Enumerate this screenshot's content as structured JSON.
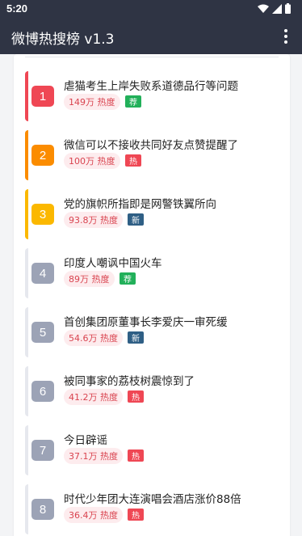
{
  "status_bar": {
    "time": "5:20"
  },
  "app_bar": {
    "title": "微博热搜榜 v1.3",
    "menu_icon": "more-vert-icon"
  },
  "colors": {
    "rank_1": "#ef4754",
    "rank_2": "#fb8c00",
    "rank_3": "#fbb800",
    "rank_other": "#9ca3b6",
    "tag_recommend": "#22b05a",
    "tag_hot": "#ef4754",
    "tag_new": "#2f5f85"
  },
  "items": [
    {
      "rank": "1",
      "title": "虐猫考生上岸失败系道德品行等问题",
      "heat": "149万 热度",
      "tag": "荐",
      "tag_type": "recommend"
    },
    {
      "rank": "2",
      "title": "微信可以不接收共同好友点赞提醒了",
      "heat": "100万 热度",
      "tag": "热",
      "tag_type": "hot"
    },
    {
      "rank": "3",
      "title": "党的旗帜所指即是网警铁翼所向",
      "heat": "93.8万 热度",
      "tag": "新",
      "tag_type": "new"
    },
    {
      "rank": "4",
      "title": "印度人嘲讽中国火车",
      "heat": "89万 热度",
      "tag": "荐",
      "tag_type": "recommend"
    },
    {
      "rank": "5",
      "title": "首创集团原董事长李爱庆一审死缓",
      "heat": "54.6万 热度",
      "tag": "新",
      "tag_type": "new"
    },
    {
      "rank": "6",
      "title": "被同事家的荔枝树震惊到了",
      "heat": "41.2万 热度",
      "tag": "热",
      "tag_type": "hot"
    },
    {
      "rank": "7",
      "title": "今日辟谣",
      "heat": "37.1万 热度",
      "tag": "热",
      "tag_type": "hot"
    },
    {
      "rank": "8",
      "title": "时代少年团大连演唱会酒店涨价88倍",
      "heat": "36.4万 热度",
      "tag": "热",
      "tag_type": "hot"
    }
  ]
}
